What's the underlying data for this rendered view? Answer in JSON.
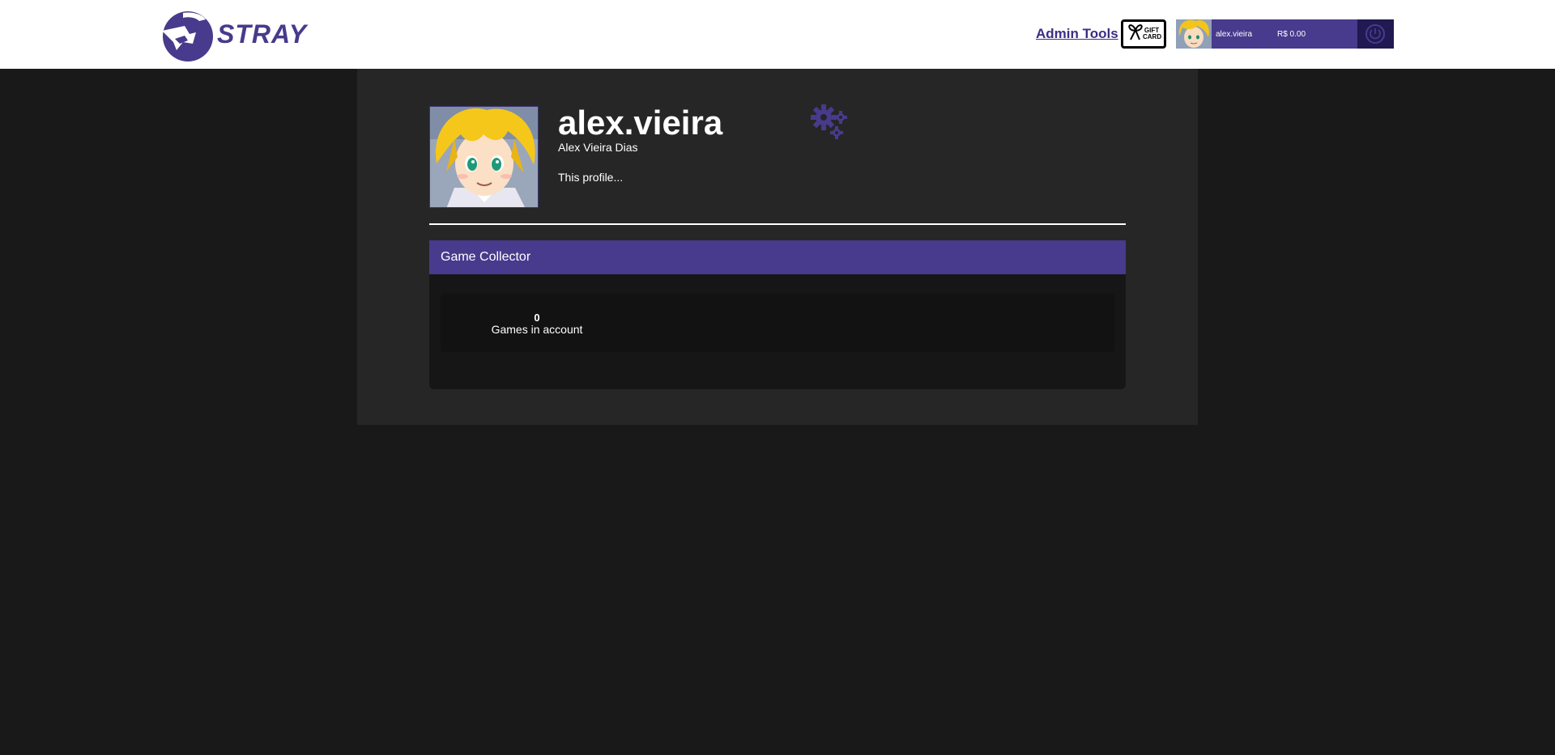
{
  "header": {
    "logo_text": "STRAY",
    "admin_tools_label": "Admin Tools",
    "giftcard_label_line1": "GIFT",
    "giftcard_label_line2": "CARD",
    "user": {
      "username": "alex.vieira",
      "balance": "R$ 0.00"
    }
  },
  "profile": {
    "username": "alex.vieira",
    "full_name": "Alex Vieira Dias",
    "summary": "This profile..."
  },
  "badge": {
    "title": "Game Collector",
    "games_count": "0",
    "games_label": "Games in account"
  },
  "colors": {
    "accent": "#483a8c",
    "page_bg": "#191919",
    "content_bg": "#262626"
  },
  "icons": {
    "settings": "gears-icon",
    "power": "power-icon",
    "giftcard": "giftcard-icon"
  }
}
